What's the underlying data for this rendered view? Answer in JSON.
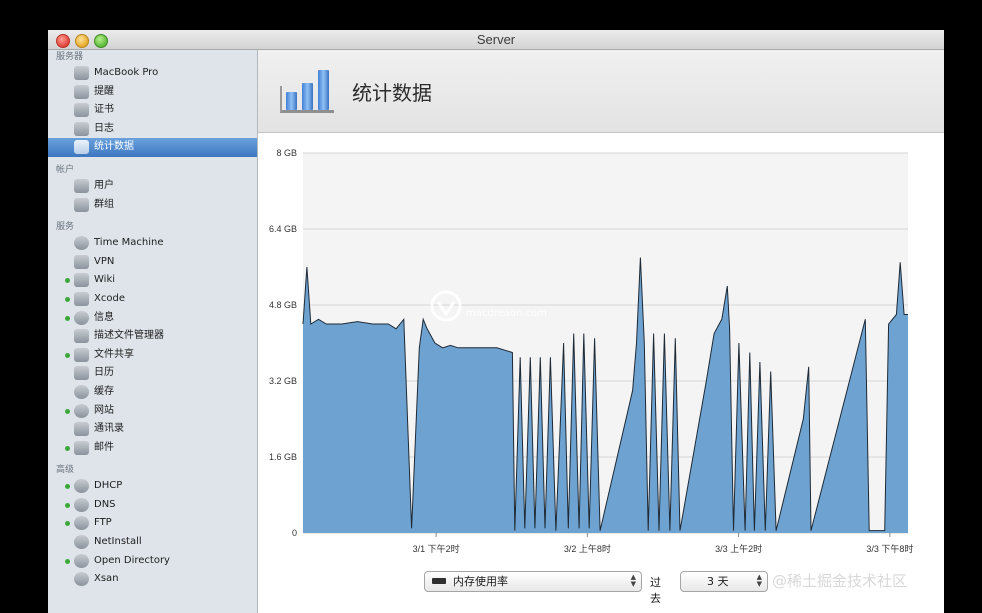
{
  "window": {
    "title": "Server"
  },
  "sidebar": {
    "sections": [
      {
        "label": "服务器",
        "items": [
          {
            "label": "MacBook Pro",
            "icon": "laptop-icon"
          },
          {
            "label": "提醒",
            "icon": "megaphone-icon"
          },
          {
            "label": "证书",
            "icon": "certificate-icon"
          },
          {
            "label": "日志",
            "icon": "log-icon"
          },
          {
            "label": "统计数据",
            "icon": "stats-icon",
            "selected": true
          }
        ]
      },
      {
        "label": "帐户",
        "items": [
          {
            "label": "用户",
            "icon": "user-icon"
          },
          {
            "label": "群组",
            "icon": "group-icon"
          }
        ]
      },
      {
        "label": "服务",
        "items": [
          {
            "label": "Time Machine",
            "icon": "time-machine-icon"
          },
          {
            "label": "VPN",
            "icon": "vpn-lock-icon"
          },
          {
            "label": "Wiki",
            "icon": "wiki-icon",
            "active": true
          },
          {
            "label": "Xcode",
            "icon": "xcode-hammer-icon",
            "active": true
          },
          {
            "label": "信息",
            "icon": "messages-icon",
            "active": true
          },
          {
            "label": "描述文件管理器",
            "icon": "profile-manager-icon"
          },
          {
            "label": "文件共享",
            "icon": "file-sharing-icon",
            "active": true
          },
          {
            "label": "日历",
            "icon": "calendar-icon"
          },
          {
            "label": "缓存",
            "icon": "caching-icon"
          },
          {
            "label": "网站",
            "icon": "globe-icon",
            "active": true
          },
          {
            "label": "通讯录",
            "icon": "contacts-icon"
          },
          {
            "label": "邮件",
            "icon": "mail-icon",
            "active": true
          }
        ]
      },
      {
        "label": "高级",
        "items": [
          {
            "label": "DHCP",
            "icon": "dhcp-icon",
            "active": true
          },
          {
            "label": "DNS",
            "icon": "dns-icon",
            "active": true
          },
          {
            "label": "FTP",
            "icon": "ftp-icon",
            "active": true
          },
          {
            "label": "NetInstall",
            "icon": "netinstall-icon"
          },
          {
            "label": "Open Directory",
            "icon": "open-directory-icon",
            "active": true
          },
          {
            "label": "Xsan",
            "icon": "xsan-icon"
          }
        ]
      }
    ]
  },
  "main": {
    "title": "统计数据"
  },
  "controls": {
    "metric": "内存使用率",
    "past_label": "过去",
    "range": "3 天"
  },
  "watermarks": {
    "center": "macdreaon.com",
    "corner": "@稀土掘金技术社区"
  },
  "chart_data": {
    "type": "area",
    "title": "",
    "xlabel": "",
    "ylabel": "",
    "ylim": [
      0,
      8
    ],
    "yticks": [
      "0",
      "1.6 GB",
      "3.2 GB",
      "4.8 GB",
      "6.4 GB",
      "8 GB"
    ],
    "xticks": [
      "3/1 下午2时",
      "3/2 上午8时",
      "3/3 上午2时",
      "3/3 下午8时"
    ],
    "grid": true,
    "fill_color": "#6ea3d1",
    "line_color": "#1e2a36",
    "points": [
      [
        0,
        4.4
      ],
      [
        0.5,
        5.6
      ],
      [
        1,
        4.4
      ],
      [
        2,
        4.5
      ],
      [
        3,
        4.4
      ],
      [
        5,
        4.4
      ],
      [
        7,
        4.45
      ],
      [
        9,
        4.4
      ],
      [
        11,
        4.4
      ],
      [
        12,
        4.3
      ],
      [
        13,
        4.5
      ],
      [
        14,
        0.1
      ],
      [
        15,
        3.9
      ],
      [
        15.5,
        4.5
      ],
      [
        16,
        4.3
      ],
      [
        17,
        4.0
      ],
      [
        18,
        3.9
      ],
      [
        19,
        3.95
      ],
      [
        20,
        3.9
      ],
      [
        21,
        3.9
      ],
      [
        23,
        3.9
      ],
      [
        25,
        3.9
      ],
      [
        27,
        3.8
      ],
      [
        27.3,
        0.05
      ],
      [
        28,
        3.7
      ],
      [
        28.6,
        0.1
      ],
      [
        29.3,
        3.7
      ],
      [
        29.9,
        0.1
      ],
      [
        30.6,
        3.7
      ],
      [
        31.2,
        0.1
      ],
      [
        31.9,
        3.7
      ],
      [
        32.6,
        0.05
      ],
      [
        33.6,
        4.0
      ],
      [
        34.2,
        0.1
      ],
      [
        34.9,
        4.2
      ],
      [
        35.6,
        0.1
      ],
      [
        36.2,
        4.2
      ],
      [
        36.9,
        0.1
      ],
      [
        37.6,
        4.1
      ],
      [
        38.3,
        0.05
      ],
      [
        42.5,
        3.0
      ],
      [
        43,
        4.0
      ],
      [
        43.5,
        5.8
      ],
      [
        44,
        4.0
      ],
      [
        44.5,
        0.05
      ],
      [
        45.2,
        4.2
      ],
      [
        45.9,
        0.05
      ],
      [
        46.6,
        4.2
      ],
      [
        47.3,
        0.05
      ],
      [
        48,
        4.1
      ],
      [
        48.6,
        0.05
      ],
      [
        52,
        3.2
      ],
      [
        53,
        4.2
      ],
      [
        54,
        4.5
      ],
      [
        54.7,
        5.2
      ],
      [
        55,
        4.3
      ],
      [
        55.5,
        0.05
      ],
      [
        56.2,
        4.0
      ],
      [
        57,
        0.05
      ],
      [
        57.6,
        3.8
      ],
      [
        58.2,
        0.05
      ],
      [
        58.9,
        3.6
      ],
      [
        59.6,
        0.05
      ],
      [
        60.3,
        3.4
      ],
      [
        61,
        0.05
      ],
      [
        64.5,
        2.4
      ],
      [
        65.2,
        3.5
      ],
      [
        65.5,
        0.05
      ],
      [
        72.5,
        4.5
      ],
      [
        73,
        0.05
      ],
      [
        75,
        0.05
      ],
      [
        75.5,
        4.4
      ],
      [
        76.5,
        4.6
      ],
      [
        77,
        5.7
      ],
      [
        77.5,
        4.6
      ],
      [
        78,
        4.6
      ]
    ],
    "x_domain": [
      0,
      78
    ]
  }
}
